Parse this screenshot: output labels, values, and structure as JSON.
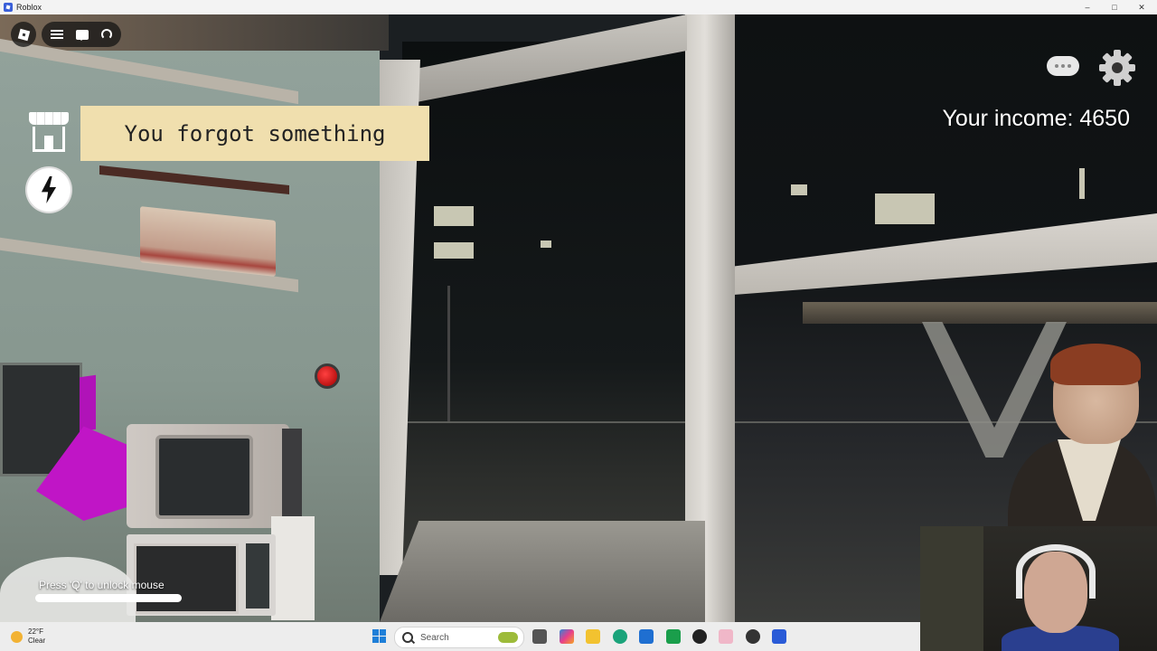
{
  "window": {
    "title": "Roblox",
    "controls": [
      "–",
      "□",
      "✕"
    ]
  },
  "top_left": {
    "roblox_menu_icon": "roblox-logo-icon",
    "icons": [
      "hamburger-menu-icon",
      "chat-icon",
      "headset-icon"
    ]
  },
  "notification": {
    "text": "You forgot something"
  },
  "side_buttons": {
    "shop_icon": "shop-icon",
    "power_icon": "lightning-bolt-icon"
  },
  "hud": {
    "income_text": "Your income: 4650",
    "chat_bubble_icon": "chat-bubble-icon",
    "settings_icon": "gear-icon"
  },
  "hint": {
    "text": "Press 'Q' to unlock mouse",
    "progress": 1.0
  },
  "taskbar": {
    "weather_temp": "22°F",
    "weather_desc": "Clear",
    "search_placeholder": "Search",
    "pinned_icons": [
      "file-explorer-icon",
      "copilot-icon",
      "folder-icon",
      "edge-icon",
      "store-icon",
      "xbox-icon",
      "obs-icon",
      "photos-icon",
      "chrome-icon",
      "roblox-icon"
    ]
  }
}
